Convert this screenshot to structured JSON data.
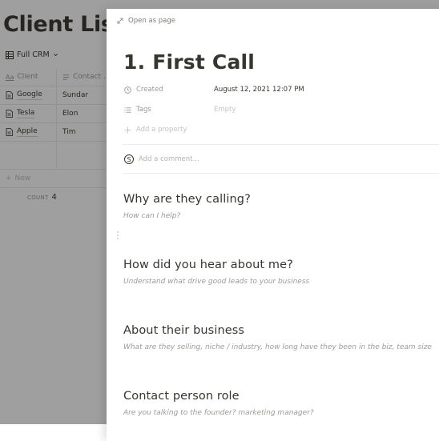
{
  "background": {
    "title": "Client List",
    "view_label": "Full CRM",
    "table": {
      "headers": [
        "Client",
        "Contact ..."
      ],
      "rows": [
        {
          "client": "Google",
          "contact": "Sundar"
        },
        {
          "client": "Tesla",
          "contact": "Elon"
        },
        {
          "client": "Apple",
          "contact": "Tim"
        }
      ],
      "new_label": "New",
      "count_label": "COUNT",
      "count_value": "4"
    }
  },
  "modal": {
    "open_as_page": "Open as page",
    "title": "1. First Call",
    "properties": [
      {
        "label": "Created",
        "value": "August 12, 2021 12:07 PM",
        "icon": "clock-icon"
      },
      {
        "label": "Tags",
        "value": "Empty",
        "icon": "list-icon"
      }
    ],
    "add_property": "Add a property",
    "comment_avatar": "S",
    "comment_placeholder": "Add a comment...",
    "sections": [
      {
        "heading": "Why are they calling?",
        "placeholder": "How can I help?"
      },
      {
        "heading": "How did you hear about me?",
        "placeholder": "Understand what drive good leads to your business"
      },
      {
        "heading": "About their business",
        "placeholder": "What are they selling, niche / industry, how long have they been in the biz, team size"
      },
      {
        "heading": "Contact person role",
        "placeholder": "Are you talking to the founder? marketing manager?"
      }
    ]
  }
}
